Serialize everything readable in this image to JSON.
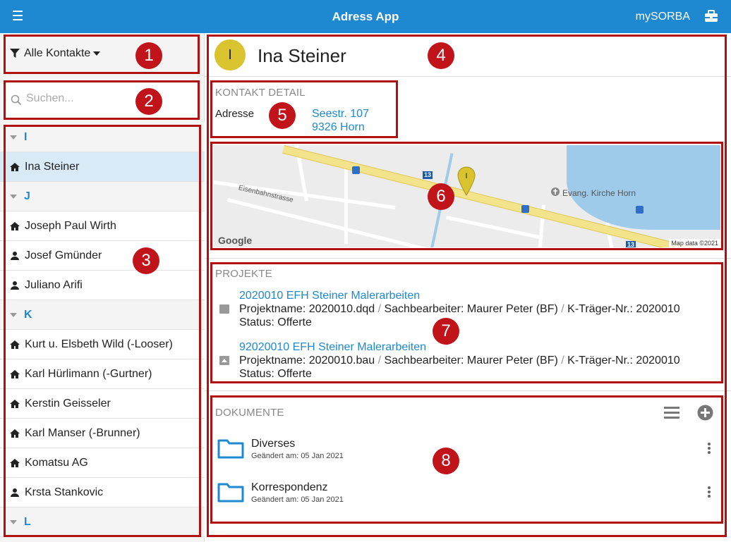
{
  "topbar": {
    "title": "Adress App",
    "brand": "mySORBA"
  },
  "sidebar": {
    "filter_label": "Alle Kontakte",
    "search_placeholder": "Suchen...",
    "contacts": [
      {
        "kind": "group",
        "label": "I"
      },
      {
        "kind": "company",
        "label": "Ina Steiner",
        "selected": true
      },
      {
        "kind": "group",
        "label": "J"
      },
      {
        "kind": "company",
        "label": "Joseph Paul Wirth"
      },
      {
        "kind": "person",
        "label": "Josef Gmünder"
      },
      {
        "kind": "person",
        "label": "Juliano Arifi"
      },
      {
        "kind": "group",
        "label": "K"
      },
      {
        "kind": "company",
        "label": "Kurt u. Elsbeth Wild (-Looser)"
      },
      {
        "kind": "company",
        "label": "Karl Hürlimann (-Gurtner)"
      },
      {
        "kind": "company",
        "label": "Kerstin Geisseler"
      },
      {
        "kind": "company",
        "label": "Karl Manser (-Brunner)"
      },
      {
        "kind": "company",
        "label": "Komatsu AG"
      },
      {
        "kind": "person",
        "label": "Krsta Stankovic"
      },
      {
        "kind": "group",
        "label": "L"
      }
    ]
  },
  "contact": {
    "initial": "I",
    "name": "Ina Steiner",
    "detail_heading": "KONTAKT DETAIL",
    "address_key": "Adresse",
    "address_line1": "Seestr. 107",
    "address_line2": "9326 Horn"
  },
  "map": {
    "street_label": "Eisenbahnstrasse",
    "church_label": "Evang. Kirche Horn",
    "road_number": "13",
    "pin_letter": "I",
    "google": "Google",
    "attribution": "Map data ©2021"
  },
  "projects": {
    "heading": "PROJEKTE",
    "items": [
      {
        "title": "2020010 EFH Steiner Malerarbeiten",
        "name_part": "Projektname: 2020010.dqd",
        "sachbearbeiter": "Sachbearbeiter: Maurer Peter (BF)",
        "traeger": "K-Träger-Nr.: 2020010",
        "status": "Status: Offerte"
      },
      {
        "title": "92020010 EFH Steiner Malerarbeiten",
        "name_part": "Projektname: 2020010.bau",
        "sachbearbeiter": "Sachbearbeiter: Maurer Peter (BF)",
        "traeger": "K-Träger-Nr.: 2020010",
        "status": "Status: Offerte"
      }
    ]
  },
  "documents": {
    "heading": "DOKUMENTE",
    "items": [
      {
        "name": "Diverses",
        "date": "Geändert am: 05 Jan 2021"
      },
      {
        "name": "Korrespondenz",
        "date": "Geändert am: 05 Jan 2021"
      }
    ]
  },
  "annotations": [
    "1",
    "2",
    "3",
    "4",
    "5",
    "6",
    "7",
    "8"
  ],
  "colors": {
    "accent": "#1e88d0",
    "annotation": "#c0141a",
    "avatar": "#d9c32e"
  }
}
